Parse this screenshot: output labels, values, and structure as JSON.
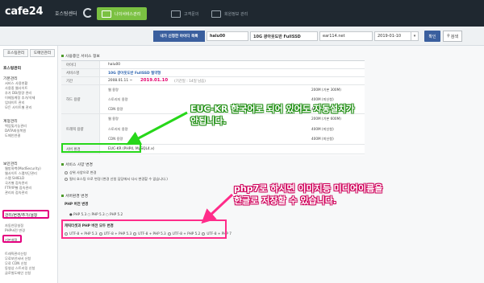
{
  "header": {
    "logo": "cafe24",
    "logo_sub": "호스팅센터",
    "tabs": [
      {
        "label": "나의서비스관리"
      },
      {
        "label": "고객문의"
      },
      {
        "label": "회원정보 관리"
      }
    ]
  },
  "selector": {
    "label": "내가 신청한 아이디 목록",
    "id_value": "halu00",
    "product_value": "10G 광아웃도반 FullSSD",
    "domain_value": "ear114.net",
    "date_value": "2019-01-10",
    "caret": "▾",
    "ok_label": "확인",
    "search_label": "검색"
  },
  "sidebar": {
    "tabs": [
      "호스팅관리",
      "도메인관리"
    ],
    "main_head": "호스팅관리",
    "sections": [
      {
        "title": "기본관리",
        "items": [
          "서비스 사용현황",
          "사용중 웹사이트",
          "추가 DB/용량 관리",
          "이메일계정 추가/삭제",
          "업데이트 관리",
          "모든 사이트별 관리"
        ]
      },
      {
        "title": "계정관리",
        "items": [
          "백업및기능관리",
          "DATA파일복원",
          "도메인연결"
        ]
      },
      {
        "title": "보안관리",
        "items": [
          "웹방화벽(ModSecurity)",
          "웹사이트 스팸차단관리",
          "스팸 SHIELD",
          "국가별 접속관리",
          "FTP/IP별 접속관리",
          "관리자 접속관리"
        ]
      },
      {
        "title": "관리/변경/추가/설정",
        "items": [
          "자동연장설정",
          "PHP버전 변경",
          "기본설정"
        ]
      },
      {
        "title": "",
        "items": [
          "트래픽관리신청",
          "무료보안서버 신청",
          "무료 CDN 신청",
          "동영상 스트리밍 신청",
          "글로벌도메인 신청"
        ]
      }
    ]
  },
  "info": {
    "section_title": "사용중인 서비스 정보",
    "rows": [
      {
        "label": "아이디",
        "value": "halu00"
      },
      {
        "label": "서비스명",
        "value": "10G 광아웃도반 FullSSD 절약형"
      },
      {
        "label": "기간",
        "value_start": "2008.01.11 ~",
        "value_end": "2019.01.10",
        "value_note": "(기간일 : 14일 남음)"
      },
      {
        "label": "하드 용량",
        "subs": [
          {
            "label": "웹 용량",
            "value": "200M (기본 300M)"
          },
          {
            "label": "스토리지 용량",
            "value": "400M (미신청)"
          },
          {
            "label": "CDN 용량",
            "value": "400M (미신청)"
          }
        ]
      },
      {
        "label": "트래픽 용량",
        "subs": [
          {
            "label": "웹 용량",
            "value": "200M (기본 600M)"
          },
          {
            "label": "스토리지 용량",
            "value": "400M (미신청)"
          },
          {
            "label": "CDN 용량",
            "value": "400M (미신청)"
          }
        ]
      },
      {
        "label": "서버 환경",
        "value": "EUC-KR (PHP4, MySQL4.x)"
      }
    ]
  },
  "service_settings": {
    "section_title": "서비스 사양 변경",
    "options": [
      "상위 사양으로 변경",
      "필더 호스팅 으로 변경 (변경 신청 담당에서 다시 변경할 수 없습니다.)"
    ]
  },
  "server_env": {
    "section_title": "서버환경 변경",
    "php_title": "PHP 버전 변경",
    "php_options": "● PHP 5.3 ○ PHP 5.3 ○ PHP 5.2",
    "charset_title": "캐릭터셋과 PHP 버전 모두 변경",
    "charset_options": [
      "UTF-8 + PHP 5.3",
      "UTF-8 + PHP 5.3",
      "UTF-8 + PHP 5.3",
      "UTF-8 + PHP 5.2",
      "UTF-8 + PHP 7"
    ]
  },
  "annotations": {
    "green_line1": "EUC-KR 한국어로 되어 있어도 자동설치가",
    "green_line2": "안됩니다.",
    "pink_line1": "php7로 하시면 이미지등 미디어이름을",
    "pink_line2": "한글로 저장할 수 있습니다."
  },
  "colors": {
    "topbar": "#1f2830",
    "accent_green": "#7bc142",
    "selector_blue": "#3a5f9e",
    "highlight_green": "#27d71a",
    "highlight_pink": "#ff2c8a"
  }
}
